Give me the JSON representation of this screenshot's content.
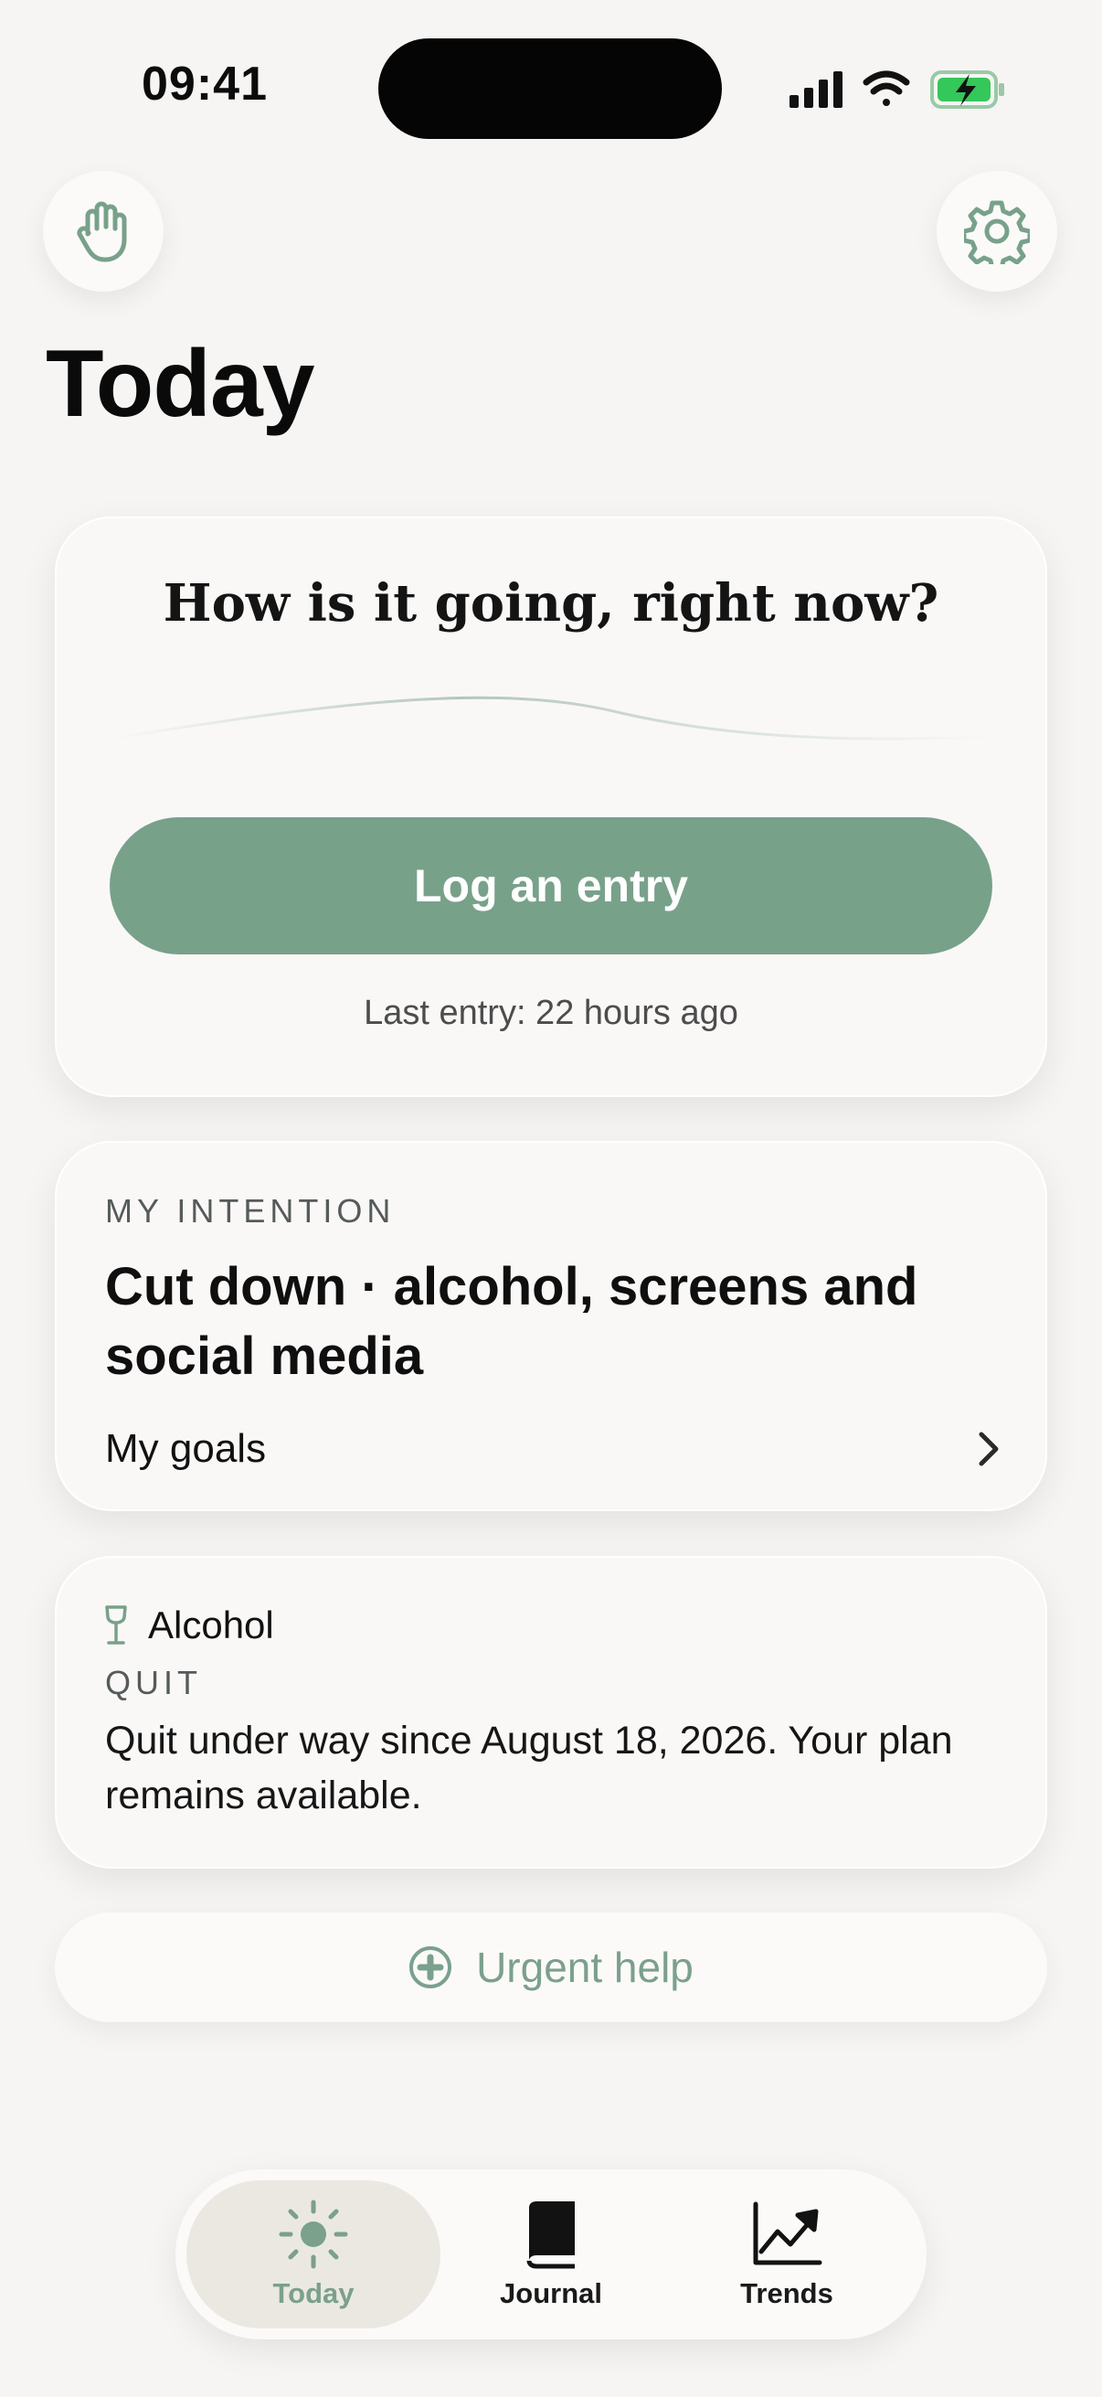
{
  "status_bar": {
    "time": "09:41"
  },
  "header": {
    "title": "Today",
    "left_icon": "hand-icon",
    "right_icon": "gear-icon"
  },
  "checkin": {
    "question": "How is it going, right now?",
    "button_label": "Log an entry",
    "last_entry": "Last entry: 22 hours ago"
  },
  "intention": {
    "eyebrow": "MY INTENTION",
    "text": "Cut down · alcohol, screens and social media",
    "goals_label": "My goals"
  },
  "alcohol": {
    "name": "Alcohol",
    "status": "QUIT",
    "description": "Quit under way since August 18, 2026. Your plan remains available."
  },
  "urgent": {
    "label": "Urgent help"
  },
  "tabs": [
    {
      "label": "Today",
      "icon": "sun-icon",
      "active": true
    },
    {
      "label": "Journal",
      "icon": "book-icon",
      "active": false
    },
    {
      "label": "Trends",
      "icon": "trend-chart-icon",
      "active": false
    }
  ],
  "colors": {
    "accent": "#78a18a",
    "background": "#f7f5f3",
    "card": "#faf8f7"
  }
}
